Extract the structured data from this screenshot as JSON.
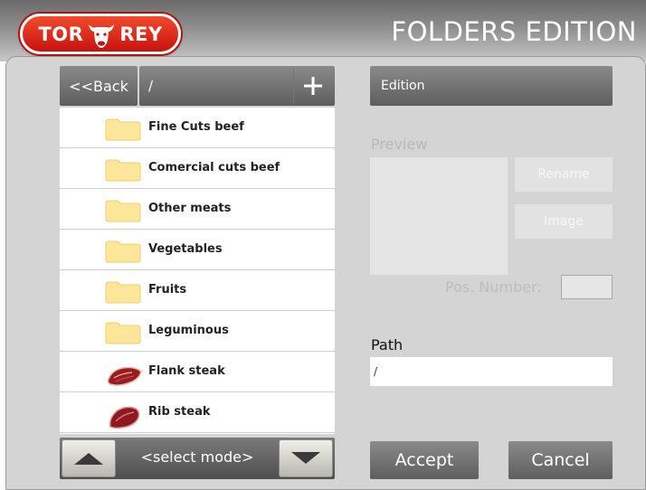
{
  "header": {
    "title": "FOLDERS EDITION",
    "logo_text_left": "TOR",
    "logo_text_right": "REY",
    "logo_mark_icon": "bull-head-icon"
  },
  "browser": {
    "back_label": "<<Back",
    "current_path": "/",
    "add_icon": "plus-icon",
    "items": [
      {
        "label": "Fine Cuts beef",
        "icon": "folder-icon"
      },
      {
        "label": "Comercial cuts beef",
        "icon": "folder-icon"
      },
      {
        "label": "Other meats",
        "icon": "folder-icon"
      },
      {
        "label": "Vegetables",
        "icon": "folder-icon"
      },
      {
        "label": "Fruits",
        "icon": "folder-icon"
      },
      {
        "label": "Leguminous",
        "icon": "folder-icon"
      },
      {
        "label": "Flank steak",
        "icon": "meat-icon"
      },
      {
        "label": "Rib steak",
        "icon": "meat-icon"
      }
    ],
    "mode_label": "<select mode>",
    "scroll_up_icon": "triangle-up-icon",
    "scroll_down_icon": "triangle-down-icon"
  },
  "edition": {
    "title": "Edition",
    "preview_label": "Preview",
    "rename_label": "Rename",
    "image_label": "Image",
    "pos_number_label": "Pos. Number:",
    "pos_number_value": "",
    "path_label": "Path",
    "path_value": "/",
    "accept_label": "Accept",
    "cancel_label": "Cancel"
  },
  "colors": {
    "brand_red": "#d8231a",
    "folder_yellow": "#fbe69a",
    "panel_gray": "#d4d4d4",
    "button_dark": "#6e6e6e"
  }
}
